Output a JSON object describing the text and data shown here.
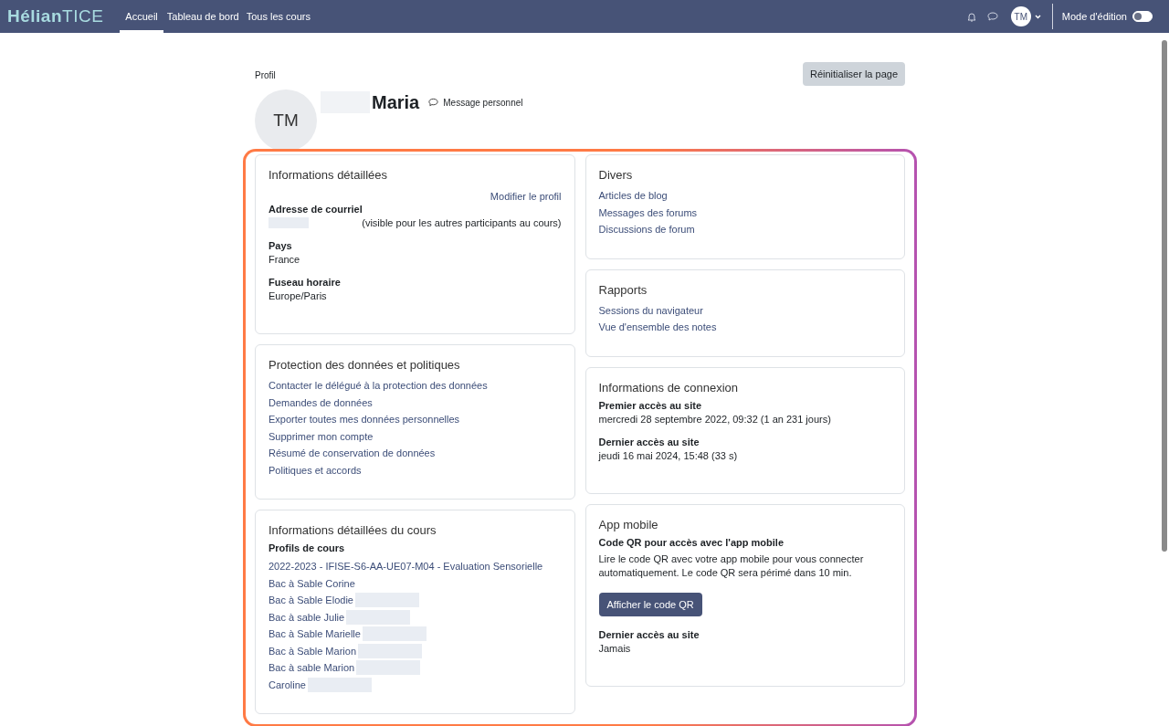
{
  "navbar": {
    "logo": {
      "first": "Hélian",
      "second": "TICE"
    },
    "links": [
      {
        "label": "Accueil",
        "selected": true
      },
      {
        "label": "Tableau de bord",
        "selected": false
      },
      {
        "label": "Tous les cours",
        "selected": false
      }
    ],
    "user_initials": "TM",
    "edit_mode": {
      "label": "Mode d'édition",
      "on": false
    }
  },
  "header": {
    "breadcrumb": "Profil",
    "reset_button": "Réinitialiser la page",
    "avatar_initials": "TM",
    "name": "Maria",
    "name_redacted": true,
    "message_link": "Message personnel"
  },
  "columns": [
    {
      "sections": [
        {
          "title": "Informations détaillées",
          "items": [
            {
              "kind": "action",
              "text": "Modifier le profil"
            },
            {
              "kind": "field",
              "label": "Adresse de courriel",
              "value": "",
              "redacted": true,
              "note": "(visible pour les autres participants au cours)"
            },
            {
              "kind": "field",
              "label": "Pays",
              "value": "France",
              "redacted": false
            },
            {
              "kind": "field",
              "label": "Fuseau horaire",
              "value": "Europe/Paris",
              "redacted": false
            }
          ]
        },
        {
          "title": "Protection des données et politiques",
          "items": [
            {
              "kind": "link",
              "text": "Contacter le délégué à la protection des données",
              "redacted": false
            },
            {
              "kind": "link",
              "text": "Demandes de données",
              "redacted": false
            },
            {
              "kind": "link",
              "text": "Exporter toutes mes données personnelles",
              "redacted": false
            },
            {
              "kind": "link",
              "text": "Supprimer mon compte",
              "redacted": false
            },
            {
              "kind": "link",
              "text": "Résumé de conservation de données",
              "redacted": false
            },
            {
              "kind": "link",
              "text": "Politiques et accords",
              "redacted": false
            }
          ]
        },
        {
          "title": "Informations détaillées du cours",
          "items": [
            {
              "kind": "label",
              "text": "Profils de cours"
            },
            {
              "kind": "link",
              "text": "2022-2023 - IFISE-S6-AA-UE07-M04 - Evaluation Sensorielle",
              "redacted": false
            },
            {
              "kind": "link",
              "text": "Bac à Sable Corine",
              "redacted": false
            },
            {
              "kind": "link",
              "text": "Bac à Sable Elodie",
              "redacted": true
            },
            {
              "kind": "link",
              "text": "Bac à sable Julie",
              "redacted": true
            },
            {
              "kind": "link",
              "text": "Bac à Sable Marielle",
              "redacted": true
            },
            {
              "kind": "link",
              "text": "Bac à Sable Marion",
              "redacted": true
            },
            {
              "kind": "link",
              "text": "Bac à sable Marion",
              "redacted": true
            },
            {
              "kind": "link",
              "text": "Caroline",
              "redacted": true
            }
          ]
        }
      ]
    },
    {
      "sections": [
        {
          "title": "Divers",
          "items": [
            {
              "kind": "link",
              "text": "Articles de blog",
              "redacted": false
            },
            {
              "kind": "link",
              "text": "Messages des forums",
              "redacted": false
            },
            {
              "kind": "link",
              "text": "Discussions de forum",
              "redacted": false
            }
          ]
        },
        {
          "title": "Rapports",
          "items": [
            {
              "kind": "link",
              "text": "Sessions du navigateur",
              "redacted": false
            },
            {
              "kind": "link",
              "text": "Vue d'ensemble des notes",
              "redacted": false
            }
          ]
        },
        {
          "title": "Informations de connexion",
          "items": [
            {
              "kind": "field",
              "label": "Premier accès au site",
              "value": "mercredi 28 septembre 2022, 09:32  (1 an 231 jours)",
              "redacted": false
            },
            {
              "kind": "field",
              "label": "Dernier accès au site",
              "value": "jeudi 16 mai 2024, 15:48  (33 s)",
              "redacted": false
            }
          ]
        },
        {
          "title": "App mobile",
          "items": [
            {
              "kind": "label",
              "text": "Code QR pour accès avec l'app mobile"
            },
            {
              "kind": "paragraph",
              "text": "Lire le code QR avec votre app mobile pour vous connecter automatiquement. Le code QR sera périmé dans 10 min."
            },
            {
              "kind": "button",
              "text": "Afficher le code QR"
            },
            {
              "kind": "field",
              "label": "Dernier accès au site",
              "value": "Jamais",
              "redacted": false
            }
          ]
        }
      ]
    }
  ]
}
